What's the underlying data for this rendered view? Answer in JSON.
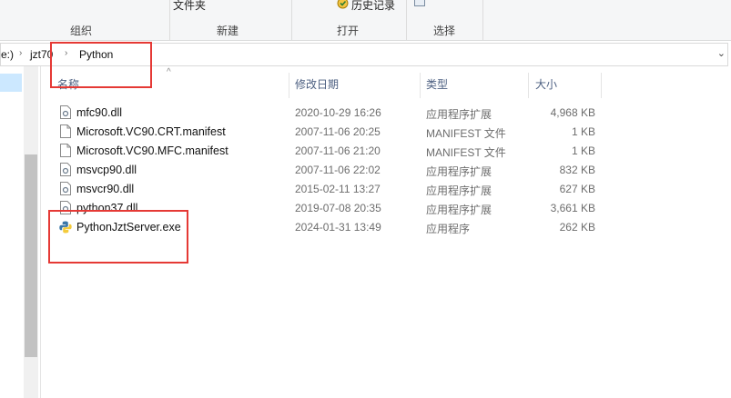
{
  "ribbon": {
    "groups": [
      {
        "label": "组织"
      },
      {
        "label": "新建"
      },
      {
        "label": "打开"
      },
      {
        "label": "选择"
      }
    ],
    "new_folder_label": "文件夹",
    "history_label": "历史记录"
  },
  "address": {
    "prefix": "e:)",
    "crumbs": [
      "jzt70",
      "Python"
    ]
  },
  "columns": {
    "name": "名称",
    "date": "修改日期",
    "type": "类型",
    "size": "大小"
  },
  "files": [
    {
      "name": "mfc90.dll",
      "date": "2020-10-29 16:26",
      "type": "应用程序扩展",
      "size": "4,968 KB",
      "icon": "dll-file-icon"
    },
    {
      "name": "Microsoft.VC90.CRT.manifest",
      "date": "2007-11-06 20:25",
      "type": "MANIFEST 文件",
      "size": "1 KB",
      "icon": "document-file-icon"
    },
    {
      "name": "Microsoft.VC90.MFC.manifest",
      "date": "2007-11-06 21:20",
      "type": "MANIFEST 文件",
      "size": "1 KB",
      "icon": "document-file-icon"
    },
    {
      "name": "msvcp90.dll",
      "date": "2007-11-06 22:02",
      "type": "应用程序扩展",
      "size": "832 KB",
      "icon": "dll-file-icon"
    },
    {
      "name": "msvcr90.dll",
      "date": "2015-02-11 13:27",
      "type": "应用程序扩展",
      "size": "627 KB",
      "icon": "dll-file-icon"
    },
    {
      "name": "python37.dll",
      "date": "2019-07-08 20:35",
      "type": "应用程序扩展",
      "size": "3,661 KB",
      "icon": "dll-file-icon"
    },
    {
      "name": "PythonJztServer.exe",
      "date": "2024-01-31 13:49",
      "type": "应用程序",
      "size": "262 KB",
      "icon": "python-exe-icon"
    }
  ],
  "colors": {
    "highlight": "#e53935",
    "header_text": "#4d6082",
    "nav_selected": "#cce8ff"
  }
}
